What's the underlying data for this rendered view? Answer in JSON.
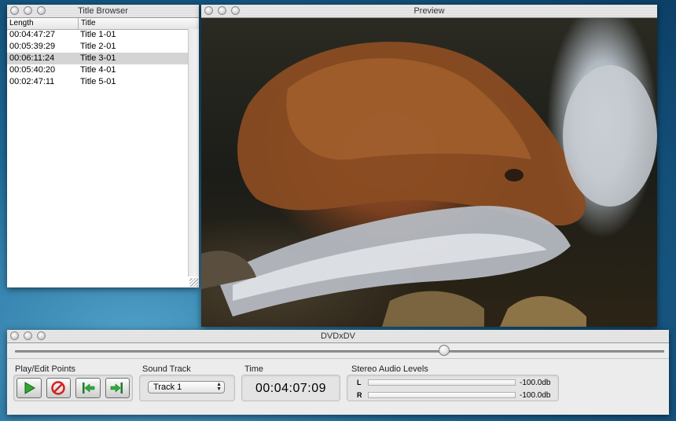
{
  "title_browser": {
    "title": "Title Browser",
    "columns": [
      "Length",
      "Title"
    ],
    "rows": [
      {
        "length": "00:04:47:27",
        "title": "Title 1-01"
      },
      {
        "length": "00:05:39:29",
        "title": "Title 2-01"
      },
      {
        "length": "00:06:11:24",
        "title": "Title 3-01"
      },
      {
        "length": "00:05:40:20",
        "title": "Title 4-01"
      },
      {
        "length": "00:02:47:11",
        "title": "Title 5-01"
      }
    ],
    "selected_row": "Title 3-01"
  },
  "preview": {
    "title": "Preview"
  },
  "main": {
    "title": "DVDxDV",
    "position_fraction": 0.67,
    "play_edit": {
      "label": "Play/Edit Points",
      "buttons": [
        "play-icon",
        "no-entry-icon",
        "set-in-point-icon",
        "set-out-point-icon"
      ]
    },
    "sound_track": {
      "label": "Sound Track",
      "value": "Track 1"
    },
    "time": {
      "label": "Time",
      "value": "00:04:07:09"
    },
    "audio": {
      "label": "Stereo Audio Levels",
      "left_label": "L",
      "right_label": "R",
      "left_db": "-100.0db",
      "right_db": "-100.0db"
    }
  },
  "colors": {
    "play_green": "#2fa82f",
    "no_red": "#d42020",
    "arrow_green": "#2eaa3a"
  }
}
